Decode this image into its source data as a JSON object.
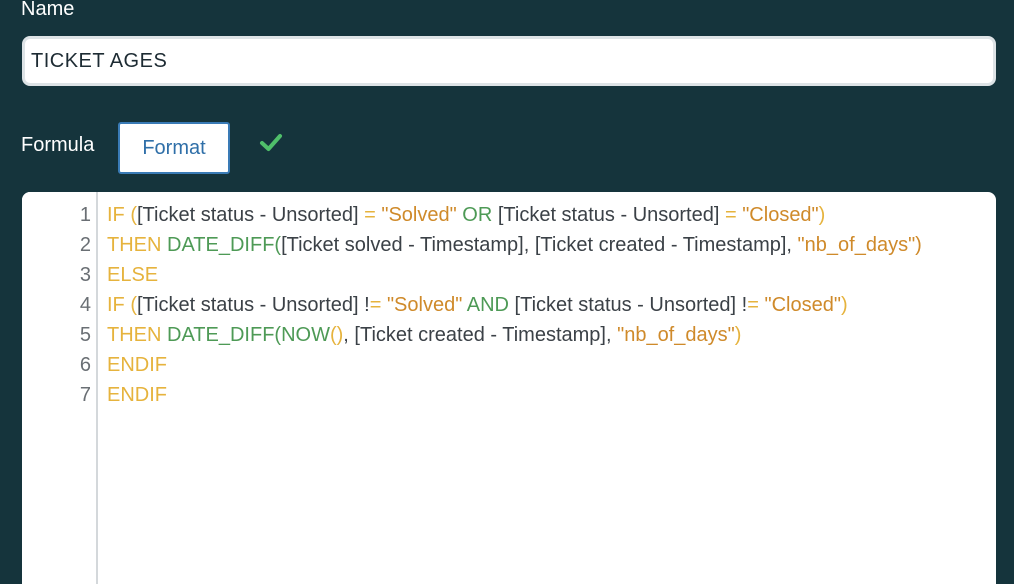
{
  "name_section": {
    "label": "Name",
    "value": "TICKET AGES"
  },
  "formula_section": {
    "label": "Formula",
    "format_button": "Format",
    "valid_icon": "check-icon",
    "valid_color": "#4fbf6a"
  },
  "editor": {
    "line_numbers": [
      "1",
      "2",
      "3",
      "4",
      "5",
      "6",
      "7"
    ],
    "lines": [
      [
        {
          "t": "kw",
          "v": "IF ("
        },
        {
          "t": "ref",
          "v": "[Ticket status - Unsorted]"
        },
        {
          "t": "op",
          "v": " = "
        },
        {
          "t": "str",
          "v": "\"Solved\""
        },
        {
          "t": "plain",
          "v": " "
        },
        {
          "t": "fn",
          "v": "OR"
        },
        {
          "t": "plain",
          "v": " "
        },
        {
          "t": "ref",
          "v": "[Ticket status - Unsorted]"
        },
        {
          "t": "op",
          "v": " = "
        },
        {
          "t": "str",
          "v": "\"Closed\""
        },
        {
          "t": "kw",
          "v": ")"
        }
      ],
      [
        {
          "t": "kw",
          "v": "THEN "
        },
        {
          "t": "fn",
          "v": "DATE_DIFF("
        },
        {
          "t": "ref",
          "v": "[Ticket solved - Timestamp]"
        },
        {
          "t": "plain",
          "v": ", "
        },
        {
          "t": "ref",
          "v": "[Ticket created - Timestamp]"
        },
        {
          "t": "plain",
          "v": ", "
        },
        {
          "t": "str",
          "v": "\"nb_of_days\")"
        }
      ],
      [
        {
          "t": "kw",
          "v": "ELSE"
        }
      ],
      [
        {
          "t": "kw",
          "v": "IF ("
        },
        {
          "t": "ref",
          "v": "[Ticket status - Unsorted]"
        },
        {
          "t": "plain",
          "v": " !"
        },
        {
          "t": "op",
          "v": "= "
        },
        {
          "t": "str",
          "v": "\"Solved\""
        },
        {
          "t": "plain",
          "v": " "
        },
        {
          "t": "fn",
          "v": "AND"
        },
        {
          "t": "plain",
          "v": " "
        },
        {
          "t": "ref",
          "v": "[Ticket status - Unsorted]"
        },
        {
          "t": "plain",
          "v": " !"
        },
        {
          "t": "op",
          "v": "= "
        },
        {
          "t": "str",
          "v": "\"Closed\""
        },
        {
          "t": "kw",
          "v": ")"
        }
      ],
      [
        {
          "t": "kw",
          "v": "THEN "
        },
        {
          "t": "fn",
          "v": "DATE_DIFF(NOW"
        },
        {
          "t": "kw",
          "v": "()"
        },
        {
          "t": "plain",
          "v": ", "
        },
        {
          "t": "ref",
          "v": "[Ticket created - Timestamp]"
        },
        {
          "t": "plain",
          "v": ", "
        },
        {
          "t": "str",
          "v": "\"nb_of_days\""
        },
        {
          "t": "kw",
          "v": ")"
        }
      ],
      [
        {
          "t": "kw",
          "v": "ENDIF"
        }
      ],
      [
        {
          "t": "kw",
          "v": "ENDIF"
        }
      ]
    ]
  }
}
